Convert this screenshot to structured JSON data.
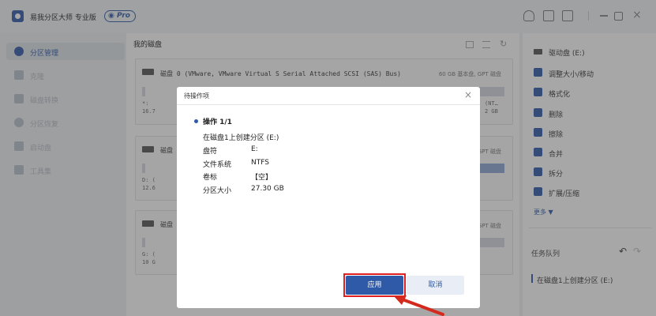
{
  "app": {
    "title": "易我分区大师 专业版",
    "badge": "Pro"
  },
  "sidebar": {
    "items": [
      {
        "label": "分区管理",
        "active": true
      },
      {
        "label": "克隆",
        "active": false
      },
      {
        "label": "磁盘转换",
        "active": false
      },
      {
        "label": "分区恢复",
        "active": false
      },
      {
        "label": "启动盘",
        "active": false
      },
      {
        "label": "工具集",
        "active": false
      }
    ]
  },
  "main": {
    "title": "我的磁盘",
    "disk0": {
      "name": "磁盘 0 (VMware, VMware Virtual S Serial Attached SCSI (SAS) Bus)",
      "info": "60 GB 基本盘, GPT 磁盘",
      "part_left": "*:",
      "part_left_size": "16.7",
      "part_right": "(NT…",
      "part_right_size": "2 GB"
    },
    "disk1": {
      "name": "磁盘",
      "info": "GPT 磁盘",
      "part_left": "D: (",
      "part_left_size": "12.6"
    },
    "disk2": {
      "name": "磁盘",
      "info": "GPT 磁盘",
      "part_left": "G: (",
      "part_left_size": "10 G"
    }
  },
  "right_panel": {
    "ops": [
      {
        "label": "驱动盘 (E:)",
        "icon": "drive-icon"
      },
      {
        "label": "调整大小/移动",
        "icon": "resize-icon"
      },
      {
        "label": "格式化",
        "icon": "format-icon"
      },
      {
        "label": "删除",
        "icon": "delete-icon"
      },
      {
        "label": "擦除",
        "icon": "wipe-icon"
      },
      {
        "label": "合并",
        "icon": "merge-icon"
      },
      {
        "label": "拆分",
        "icon": "split-icon"
      },
      {
        "label": "扩展/压缩",
        "icon": "expand-icon"
      }
    ],
    "more": "更多 ▼",
    "queue_title": "任务队列",
    "queue_item": "在磁盘1上创建分区 (E:)"
  },
  "dialog": {
    "title": "待操作项",
    "op_head": "操作 1/1",
    "op_desc": "在磁盘1上创建分区 (E:)",
    "rows": [
      {
        "key": "盘符",
        "value": "E:"
      },
      {
        "key": "文件系统",
        "value": "NTFS"
      },
      {
        "key": "卷标",
        "value": "【空】"
      },
      {
        "key": "分区大小",
        "value": "27.30 GB"
      }
    ],
    "apply": "应用",
    "cancel": "取消"
  },
  "colors": {
    "accent": "#2e5aa8",
    "highlight": "#e02020"
  }
}
